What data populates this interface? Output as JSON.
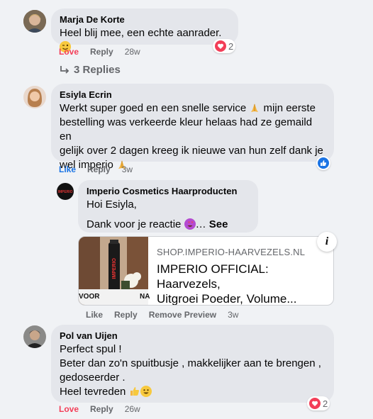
{
  "comments": [
    {
      "author": "Marja De Korte",
      "text": "Heel blij mee, een echte aanrader.",
      "actions": {
        "react": "Love",
        "reply": "Reply",
        "time": "28w"
      },
      "reaction_count": "2"
    },
    {
      "replies_label": "3 Replies"
    },
    {
      "author": "Esiyla Ecrin",
      "text_lines": [
        "Werkt super goed en een snelle service",
        "mijn eerste",
        "bestelling was verkeerde kleur helaas had ze gemaild en",
        "gelijk over 2 dagen kreeg ik nieuwe van hun zelf dank je",
        "wel imperio"
      ],
      "actions": {
        "react": "Like",
        "reply": "Reply",
        "time": "3w"
      }
    },
    {
      "author": "Imperio Cosmetics Haarproducten",
      "line1": "Hoi Esiyla,",
      "line2": "Dank voor je reactie",
      "see_more": "See more",
      "link": {
        "domain": "SHOP.IMPERIO-HAARVEZELS.NL",
        "title_line1": "IMPERIO OFFICIAL: Haarvezels,",
        "title_line2": "Uitgroei Poeder, Volume...",
        "thumb_brand": "IMPERIO",
        "thumb_left": "VOOR",
        "thumb_right": "NA",
        "info": "i"
      },
      "actions": {
        "react": "Like",
        "reply": "Reply",
        "remove": "Remove Preview",
        "time": "3w"
      }
    },
    {
      "author": "Pol van Uijen",
      "text_lines": [
        "Perfect spul !",
        "Beter dan zo'n spuitbusje , makkelijker aan te brengen ,",
        "gedoseerder .",
        "Heel tevreden"
      ],
      "actions": {
        "react": "Love",
        "reply": "Reply",
        "time": "26w"
      },
      "reaction_count": "2"
    }
  ],
  "colors": {
    "background": "#f0f2f5",
    "bubble": "#e4e6eb",
    "love": "#f33e58",
    "like": "#1b74e4",
    "muted": "#65676b"
  },
  "icons": [
    "heart-reaction-icon",
    "like-reaction-icon",
    "reply-arrow-icon",
    "info-icon",
    "wink-emoji-icon",
    "pray-emoji-icon",
    "heart-eyes-emoji-icon",
    "thumbs-up-emoji-icon",
    "smile-emoji-icon"
  ]
}
